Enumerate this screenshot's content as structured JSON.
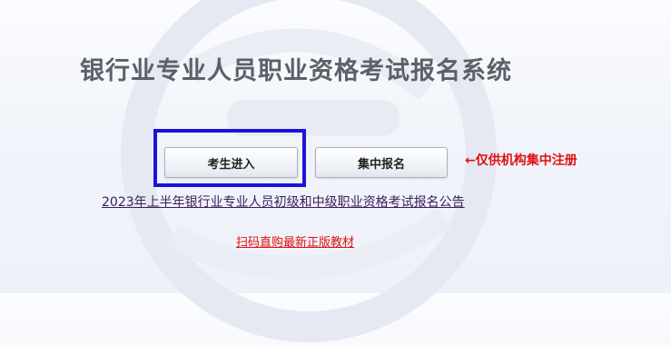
{
  "title": "银行业专业人员职业资格考试报名系统",
  "buttons": {
    "candidate_entry": "考生进入",
    "group_registration": "集中报名"
  },
  "note": "←仅供机构集中注册",
  "links": {
    "announcement": "2023年上半年银行业专业人员初级和中级职业资格考试报名公告",
    "books": "扫码直购最新正版教材"
  },
  "colors": {
    "highlight_border": "#1a15d6",
    "note_red": "#e01010",
    "title_gray": "#5b6169"
  }
}
